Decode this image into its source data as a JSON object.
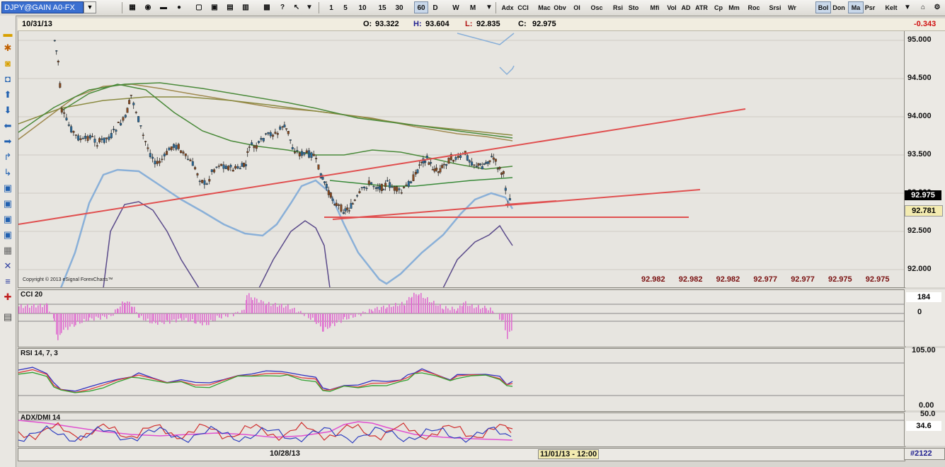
{
  "toolbar": {
    "symbol": "DJPY@GAIN A0-FX",
    "intervals": [
      "1",
      "5",
      "10",
      "15",
      "30",
      "60",
      "D",
      "W",
      "M"
    ],
    "active_interval": "60",
    "studies": [
      "Adx",
      "CCI",
      "Mac",
      "Obv",
      "OI",
      "Osc",
      "Rsi",
      "Sto",
      "Mfi",
      "Vol",
      "AD",
      "ATR",
      "Cp",
      "Mm",
      "Roc",
      "Srsi",
      "Wr",
      "Bol",
      "Don",
      "Ma",
      "Psr",
      "Kelt"
    ],
    "active_studies": [
      "Bol",
      "Ma"
    ]
  },
  "price_panel": {
    "date": "10/31/13",
    "open_label": "O:",
    "open": "93.322",
    "high_label": "H:",
    "high": "93.604",
    "low_label": "L:",
    "low": "92.835",
    "close_label": "C:",
    "close": "92.975",
    "change": "-0.343",
    "copyright": "Copyright © 2013 eSignal ForexCharts™",
    "y_ticks": [
      "95.000",
      "94.500",
      "94.000",
      "93.500",
      "93.000",
      "92.500",
      "92.000"
    ],
    "last_price": "92.975",
    "line_price": "92.781",
    "projection_values": [
      "92.982",
      "92.982",
      "92.982",
      "92.977",
      "92.977",
      "92.975",
      "92.975"
    ],
    "colors": {
      "up": "#8a4a20",
      "down": "#2a6a9a",
      "trendline": "#e05050",
      "bb": "#8ab0d8",
      "bb_outer": "#5a4a8a",
      "ma_green": "#4a8a3a",
      "ma_olive": "#a08a50"
    }
  },
  "cci_panel": {
    "title": "CCI 20",
    "value": "184",
    "zero": "0"
  },
  "rsi_panel": {
    "title": "RSI 14, 7, 3",
    "top": "105.00",
    "bottom": "0.00"
  },
  "adx_panel": {
    "title": "ADX/DMI 14",
    "top": "50.0",
    "value": "34.6"
  },
  "date_axis": {
    "date1": "10/28/13",
    "cursor_date": "11/01/13 - 12:00",
    "bar_count": "#2122"
  }
}
